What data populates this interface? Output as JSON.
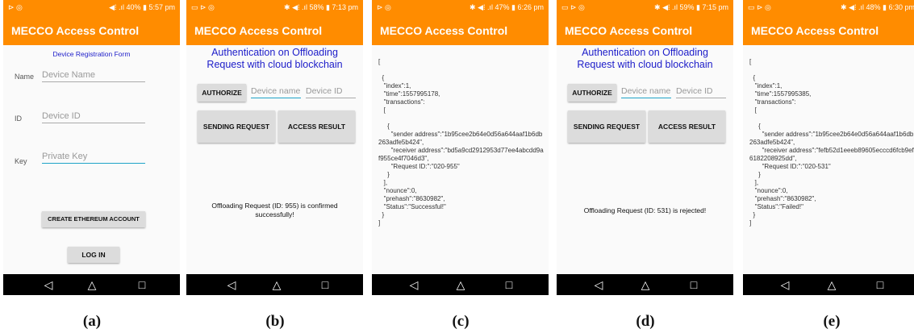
{
  "app_title": "MECCO Access Control",
  "nav": {
    "back": "◁",
    "home": "△",
    "recent": "□"
  },
  "phones": [
    {
      "status_left": "⊳ ◎",
      "status_right": "◀⁞ .ıl 40% ▮ 5:57 pm"
    },
    {
      "status_left": "▭ ⊳ ◎",
      "status_right": "✱ ◀⁞ .ıl 58% ▮ 7:13 pm"
    },
    {
      "status_left": "⊳ ◎",
      "status_right": "✱ ◀⁞ .ıl 47% ▮ 6:26 pm"
    },
    {
      "status_left": "▭ ⊳ ◎",
      "status_right": "✱ ◀⁞ .ıl 59% ▮ 7:15 pm"
    },
    {
      "status_left": "▭ ⊳ ◎",
      "status_right": "✱ ◀⁞ .ıl 48% ▮ 6:30 pm"
    }
  ],
  "a": {
    "form_title": "Device Registration Form",
    "name_label": "Name",
    "name_placeholder": "Device Name",
    "id_label": "ID",
    "id_placeholder": "Device ID",
    "key_label": "Key",
    "key_placeholder": "Private Key",
    "create_button": "CREATE ETHEREUM ACCOUNT",
    "login_button": "LOG IN"
  },
  "auth": {
    "title_line1": "Authentication on Offloading",
    "title_line2": "Request with cloud blockchain",
    "authorize_button": "AUTHORIZE",
    "device_name_placeholder": "Device name",
    "device_id_placeholder": "Device ID",
    "sending_button": "SENDING REQUEST",
    "access_button": "ACCESS RESULT"
  },
  "b": {
    "message": "Offloading Request (ID: 955) is confirmed successfully!"
  },
  "c": {
    "json": "[\n\n  {\n   \"index\":1,\n   \"time\":1557995178,\n   \"transactions\":\n   [\n\n     {\n       \"sender address\":\"1b95cee2b64e0d56a644aaf1b6db263adfe5b424\",\n       \"receiver address\":\"bd5a9cd2912953d77ee4abcdd9af955ce4f7046d3\",\n       \"Request ID:\":\"020-955\"\n     }\n   ],\n   \"nounce\":0,\n   \"prehash\":\"8630982\",\n   \"Status\":\"Successful!\"\n  }\n]"
  },
  "d": {
    "message": "Offloading Request (ID: 531) is rejected!"
  },
  "e": {
    "json": "[\n\n  {\n   \"index\":1,\n   \"time\":1557995385,\n   \"transactions\":\n   [\n\n     {\n       \"sender address\":\"1b95cee2b64e0d56a644aaf1b6db263adfe5b424\",\n       \"receiver address\":\"fefb52d1eeeb89605ecccd6fcb9ef6182208925dd\",\n       \"Request ID:\":\"020-531\"\n     }\n   ],\n   \"nounce\":0,\n   \"prehash\":\"8630982\",\n   \"Status\":\"Failed!\"\n  }\n]"
  },
  "captions": [
    "(a)",
    "(b)",
    "(c)",
    "(d)",
    "(e)"
  ]
}
